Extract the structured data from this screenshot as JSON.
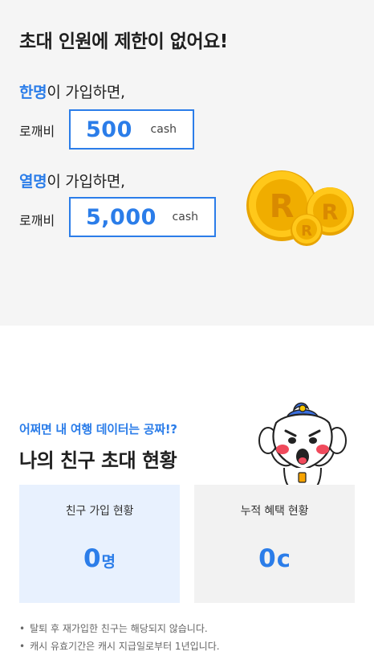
{
  "invite": {
    "headline": "초대 인원에 제한이 없어요!",
    "tier1": {
      "highlight": "한명",
      "text": "이 가입하면,",
      "reward_label": "로깨비",
      "amount": "500",
      "unit": "cash"
    },
    "tier2": {
      "highlight": "열명",
      "text": "이 가입하면,",
      "reward_label": "로깨비",
      "amount": "5,000",
      "unit": "cash"
    },
    "coin_letter": "R"
  },
  "status": {
    "teaser": "어쩌면 내 여행 데이터는 공짜!?",
    "title": "나의 친구 초대 현황",
    "friends_card": {
      "title": "친구 가입 현황",
      "value": "0",
      "unit": "명"
    },
    "benefit_card": {
      "title": "누적 혜택 현황",
      "value": "0",
      "unit": "c"
    }
  },
  "notes": [
    "탈퇴 후 재가입한 친구는 해당되지 않습니다.",
    "캐시 유효기간은 캐시 지급일로부터 1년입니다."
  ],
  "colors": {
    "accent": "#2b7de9",
    "top_bg": "#f5f5f5",
    "card_left_bg": "#e8f1fe",
    "card_right_bg": "#f2f2f2",
    "coin": "#f5b800"
  },
  "icons": {
    "coins": "gold-coins-icon",
    "mascot": "goblin-mascot-icon"
  }
}
